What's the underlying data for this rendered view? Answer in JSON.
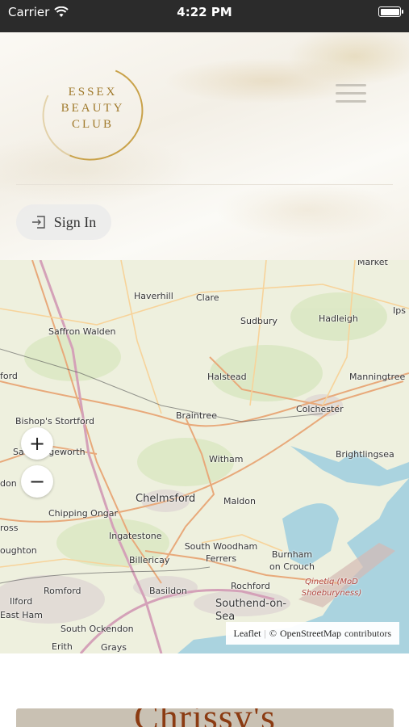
{
  "status_bar": {
    "carrier": "Carrier",
    "time": "4:22 PM"
  },
  "brand": {
    "logo_lines": [
      "ESSEX",
      "BEAUTY",
      "CLUB"
    ],
    "accent": "#c9a24a"
  },
  "header": {
    "signin_label": "Sign In"
  },
  "map": {
    "places": [
      {
        "name": "Haverhill"
      },
      {
        "name": "Clare"
      },
      {
        "name": "Sudbury"
      },
      {
        "name": "Hadleigh"
      },
      {
        "name": "Saffron Walden"
      },
      {
        "name": "Halstead"
      },
      {
        "name": "Manningtree"
      },
      {
        "name": "Colchester"
      },
      {
        "name": "Braintree"
      },
      {
        "name": "Bishop's Stortford"
      },
      {
        "name": "Sawbridgeworth"
      },
      {
        "name": "Witham"
      },
      {
        "name": "Brightlingsea"
      },
      {
        "name": "Chelmsford"
      },
      {
        "name": "Maldon"
      },
      {
        "name": "Chipping Ongar"
      },
      {
        "name": "Ingatestone"
      },
      {
        "name": "South Woodham Ferrers"
      },
      {
        "name": "Burnham on Crouch"
      },
      {
        "name": "Billericay"
      },
      {
        "name": "Basildon"
      },
      {
        "name": "Rochford"
      },
      {
        "name": "Romford"
      },
      {
        "name": "Ilford"
      },
      {
        "name": "East Ham"
      },
      {
        "name": "Southend-on-Sea"
      },
      {
        "name": "South Ockendon"
      },
      {
        "name": "Erith"
      },
      {
        "name": "Grays"
      },
      {
        "name": "Qinetiq (MoD Shoeburyness)"
      },
      {
        "name": "Market"
      },
      {
        "name": "Ips"
      },
      {
        "name": "ford"
      },
      {
        "name": "don"
      },
      {
        "name": "ross"
      },
      {
        "name": "oughton"
      }
    ],
    "zoom_in": "+",
    "zoom_out": "−",
    "attribution": {
      "leaflet": "Leaflet",
      "separator": "|",
      "copyright": "©",
      "osm": "OpenStreetMap",
      "suffix": "contributors"
    }
  },
  "card": {
    "title": "Chrissy's"
  }
}
